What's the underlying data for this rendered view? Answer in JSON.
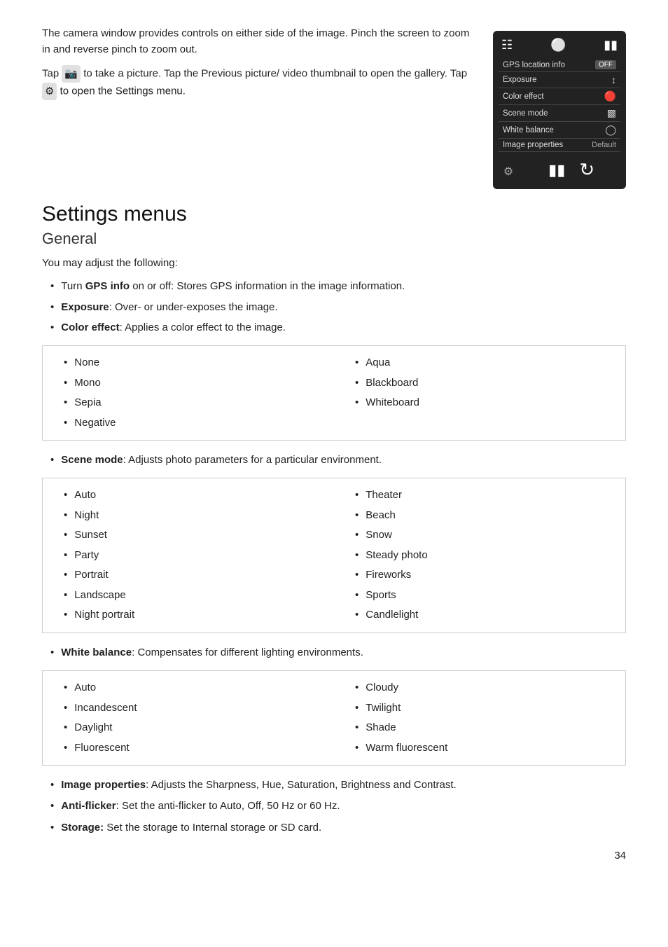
{
  "intro": {
    "paragraph1": "The camera window provides controls on either side of the image. Pinch the screen to zoom in and reverse pinch to zoom out.",
    "paragraph2_pre": "Tap ",
    "paragraph2_mid": " to take a picture. Tap the Previous picture/ video thumbnail to open the gallery. Tap ",
    "paragraph2_post": " to open the Settings menu."
  },
  "camera_ui": {
    "top_icon1": "⊞",
    "top_icon2": "⊙",
    "top_icon3": "▶◀",
    "rows": [
      {
        "label": "GPS location info",
        "value": "OFF",
        "type": "off"
      },
      {
        "label": "Exposure",
        "value": "↕",
        "type": "icon"
      },
      {
        "label": "Color effect",
        "value": "🔴",
        "type": "icon"
      },
      {
        "label": "Scene mode",
        "value": "▣",
        "type": "icon"
      },
      {
        "label": "White balance",
        "value": "⊙",
        "type": "icon"
      },
      {
        "label": "Image properties",
        "value": "Default",
        "type": "text"
      }
    ],
    "bottom_icon1": "▶◀",
    "bottom_icon2": "↺"
  },
  "sections": {
    "title": "Settings menus",
    "subsection": "General",
    "intro": "You may adjust the following:",
    "main_items": [
      {
        "prefix": "Turn ",
        "bold": "GPS info",
        "suffix": " on or off: Stores GPS information in the image information."
      },
      {
        "prefix": "",
        "bold": "Exposure",
        "suffix": ": Over- or under-exposes the image."
      },
      {
        "prefix": "",
        "bold": "Color effect",
        "suffix": ": Applies a color effect to the image."
      }
    ],
    "color_effect_items": {
      "left": [
        "None",
        "Mono",
        "Sepia",
        "Negative"
      ],
      "right": [
        "Aqua",
        "Blackboard",
        "Whiteboard"
      ]
    },
    "scene_mode_intro_pre": "",
    "scene_mode_bold": "Scene mode",
    "scene_mode_suffix": ": Adjusts photo parameters for a particular environment.",
    "scene_mode_items": {
      "left": [
        "Auto",
        "Night",
        "Sunset",
        "Party",
        "Portrait",
        "Landscape",
        "Night portrait"
      ],
      "right": [
        "Theater",
        "Beach",
        "Snow",
        "Steady photo",
        "Fireworks",
        "Sports",
        "Candlelight"
      ]
    },
    "white_balance_bold": "White balance",
    "white_balance_suffix": ": Compensates for different lighting environments.",
    "white_balance_items": {
      "left": [
        "Auto",
        "Incandescent",
        "Daylight",
        "Fluorescent"
      ],
      "right": [
        "Cloudy",
        "Twilight",
        "Shade",
        "Warm fluorescent"
      ]
    },
    "bottom_items": [
      {
        "bold": "Image properties",
        "suffix": ": Adjusts the Sharpness, Hue, Saturation, Brightness and Contrast."
      },
      {
        "bold": "Anti-flicker",
        "suffix": ": Set the anti-flicker to Auto, Off, 50 Hz or 60 Hz."
      },
      {
        "bold": "Storage:",
        "suffix": " Set the storage to Internal storage or SD card."
      }
    ]
  },
  "page_number": "34"
}
